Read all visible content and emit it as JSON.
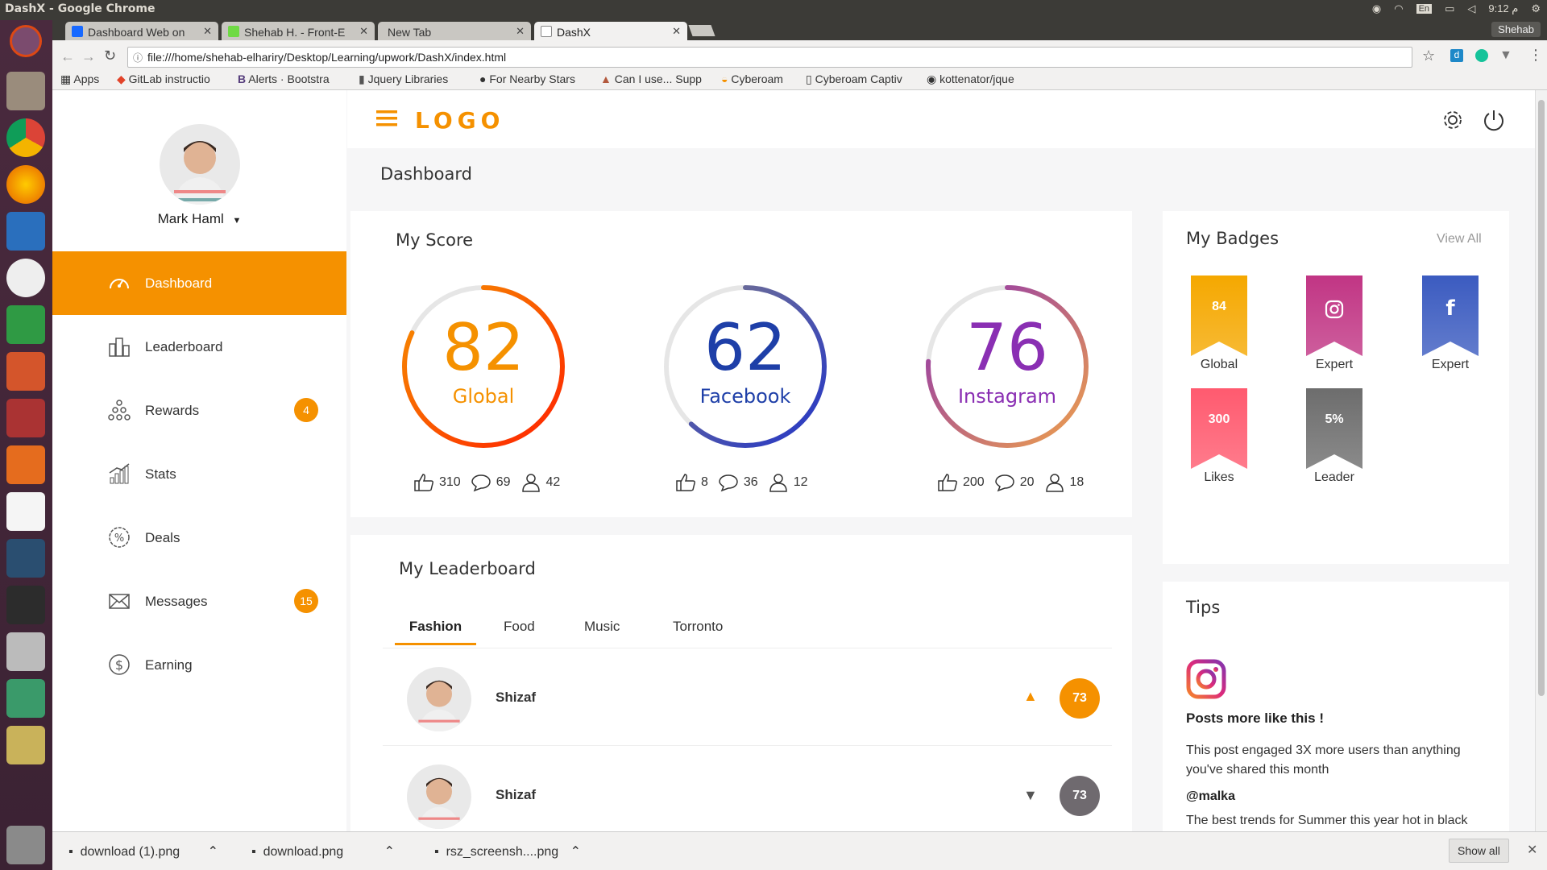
{
  "window": {
    "title": "DashX - Google Chrome",
    "time": "9:12 م",
    "user": "Shehab",
    "lang": "En"
  },
  "tabs": [
    {
      "label": "Dashboard Web on",
      "favicon": "behance-icon",
      "color": "#1769ff"
    },
    {
      "label": "Shehab H. - Front-E",
      "favicon": "upwork-icon",
      "color": "#6fda44"
    },
    {
      "label": "New Tab",
      "favicon": "",
      "color": ""
    },
    {
      "label": "DashX",
      "favicon": "page-icon",
      "color": "#888"
    }
  ],
  "address": {
    "url": "file:///home/shehab-elhariry/Desktop/Learning/upwork/DashX/index.html"
  },
  "bookmarks": [
    "Apps",
    "GitLab instructio",
    "Alerts · Bootstra",
    "Jquery Libraries",
    "For Nearby Stars",
    "Can I use... Supp",
    "Cyberoam",
    "Cyberoam Captiv",
    "kottenator/jque"
  ],
  "profile": {
    "name": "Mark Haml"
  },
  "header": {
    "logo": "LOGO",
    "page_title": "Dashboard"
  },
  "nav": [
    {
      "label": "Dashboard",
      "icon": "speedometer-icon",
      "active": true
    },
    {
      "label": "Leaderboard",
      "icon": "buildings-icon"
    },
    {
      "label": "Rewards",
      "icon": "pyramid-icon",
      "badge": "4"
    },
    {
      "label": "Stats",
      "icon": "bar-chart-icon"
    },
    {
      "label": "Deals",
      "icon": "percent-badge-icon"
    },
    {
      "label": "Messages",
      "icon": "envelope-icon",
      "badge": "15"
    },
    {
      "label": "Earning",
      "icon": "dollar-icon"
    }
  ],
  "score": {
    "title": "My Score",
    "items": [
      {
        "value": "82",
        "label": "Global",
        "color": "#f59100",
        "likes": "310",
        "comments": "69",
        "followers": "42",
        "progress": 0.82
      },
      {
        "value": "62",
        "label": "Facebook",
        "color": "#1e3fa8",
        "likes": "8",
        "comments": "36",
        "followers": "12",
        "progress": 0.62
      },
      {
        "value": "76",
        "label": "Instagram",
        "color": "#8a2fb3",
        "likes": "200",
        "comments": "20",
        "followers": "18",
        "progress": 0.76
      }
    ]
  },
  "badges": {
    "title": "My Badges",
    "view_all": "View All",
    "items": [
      {
        "top": "84",
        "label": "Global",
        "color": "#f5a800",
        "icon": ""
      },
      {
        "top": "",
        "label": "Expert",
        "color": "#c13584",
        "icon": "instagram-icon"
      },
      {
        "top": "",
        "label": "Expert",
        "color": "#3b5bc0",
        "icon": "facebook-icon"
      },
      {
        "top": "300",
        "label": "Likes",
        "color": "#ff5a6f",
        "icon": ""
      },
      {
        "top": "5%",
        "label": "Leader",
        "color": "#6d6d6d",
        "icon": ""
      }
    ]
  },
  "leaderboard": {
    "title": "My Leaderboard",
    "tabs": [
      "Fashion",
      "Food",
      "Music",
      "Torronto"
    ],
    "rows": [
      {
        "name": "Shizaf",
        "score": "73",
        "trend": "up"
      },
      {
        "name": "Shizaf",
        "score": "73",
        "trend": "down"
      }
    ]
  },
  "tips": {
    "title": "Tips",
    "heading": "Posts more like this !",
    "body": "This post engaged 3X more users than anything you've shared this month",
    "handle": "@malka",
    "more": "The best trends for Summer this year hot in black"
  },
  "downloads": [
    "download (1).png",
    "download.png",
    "rsz_screensh....png"
  ],
  "show_all": "Show all"
}
